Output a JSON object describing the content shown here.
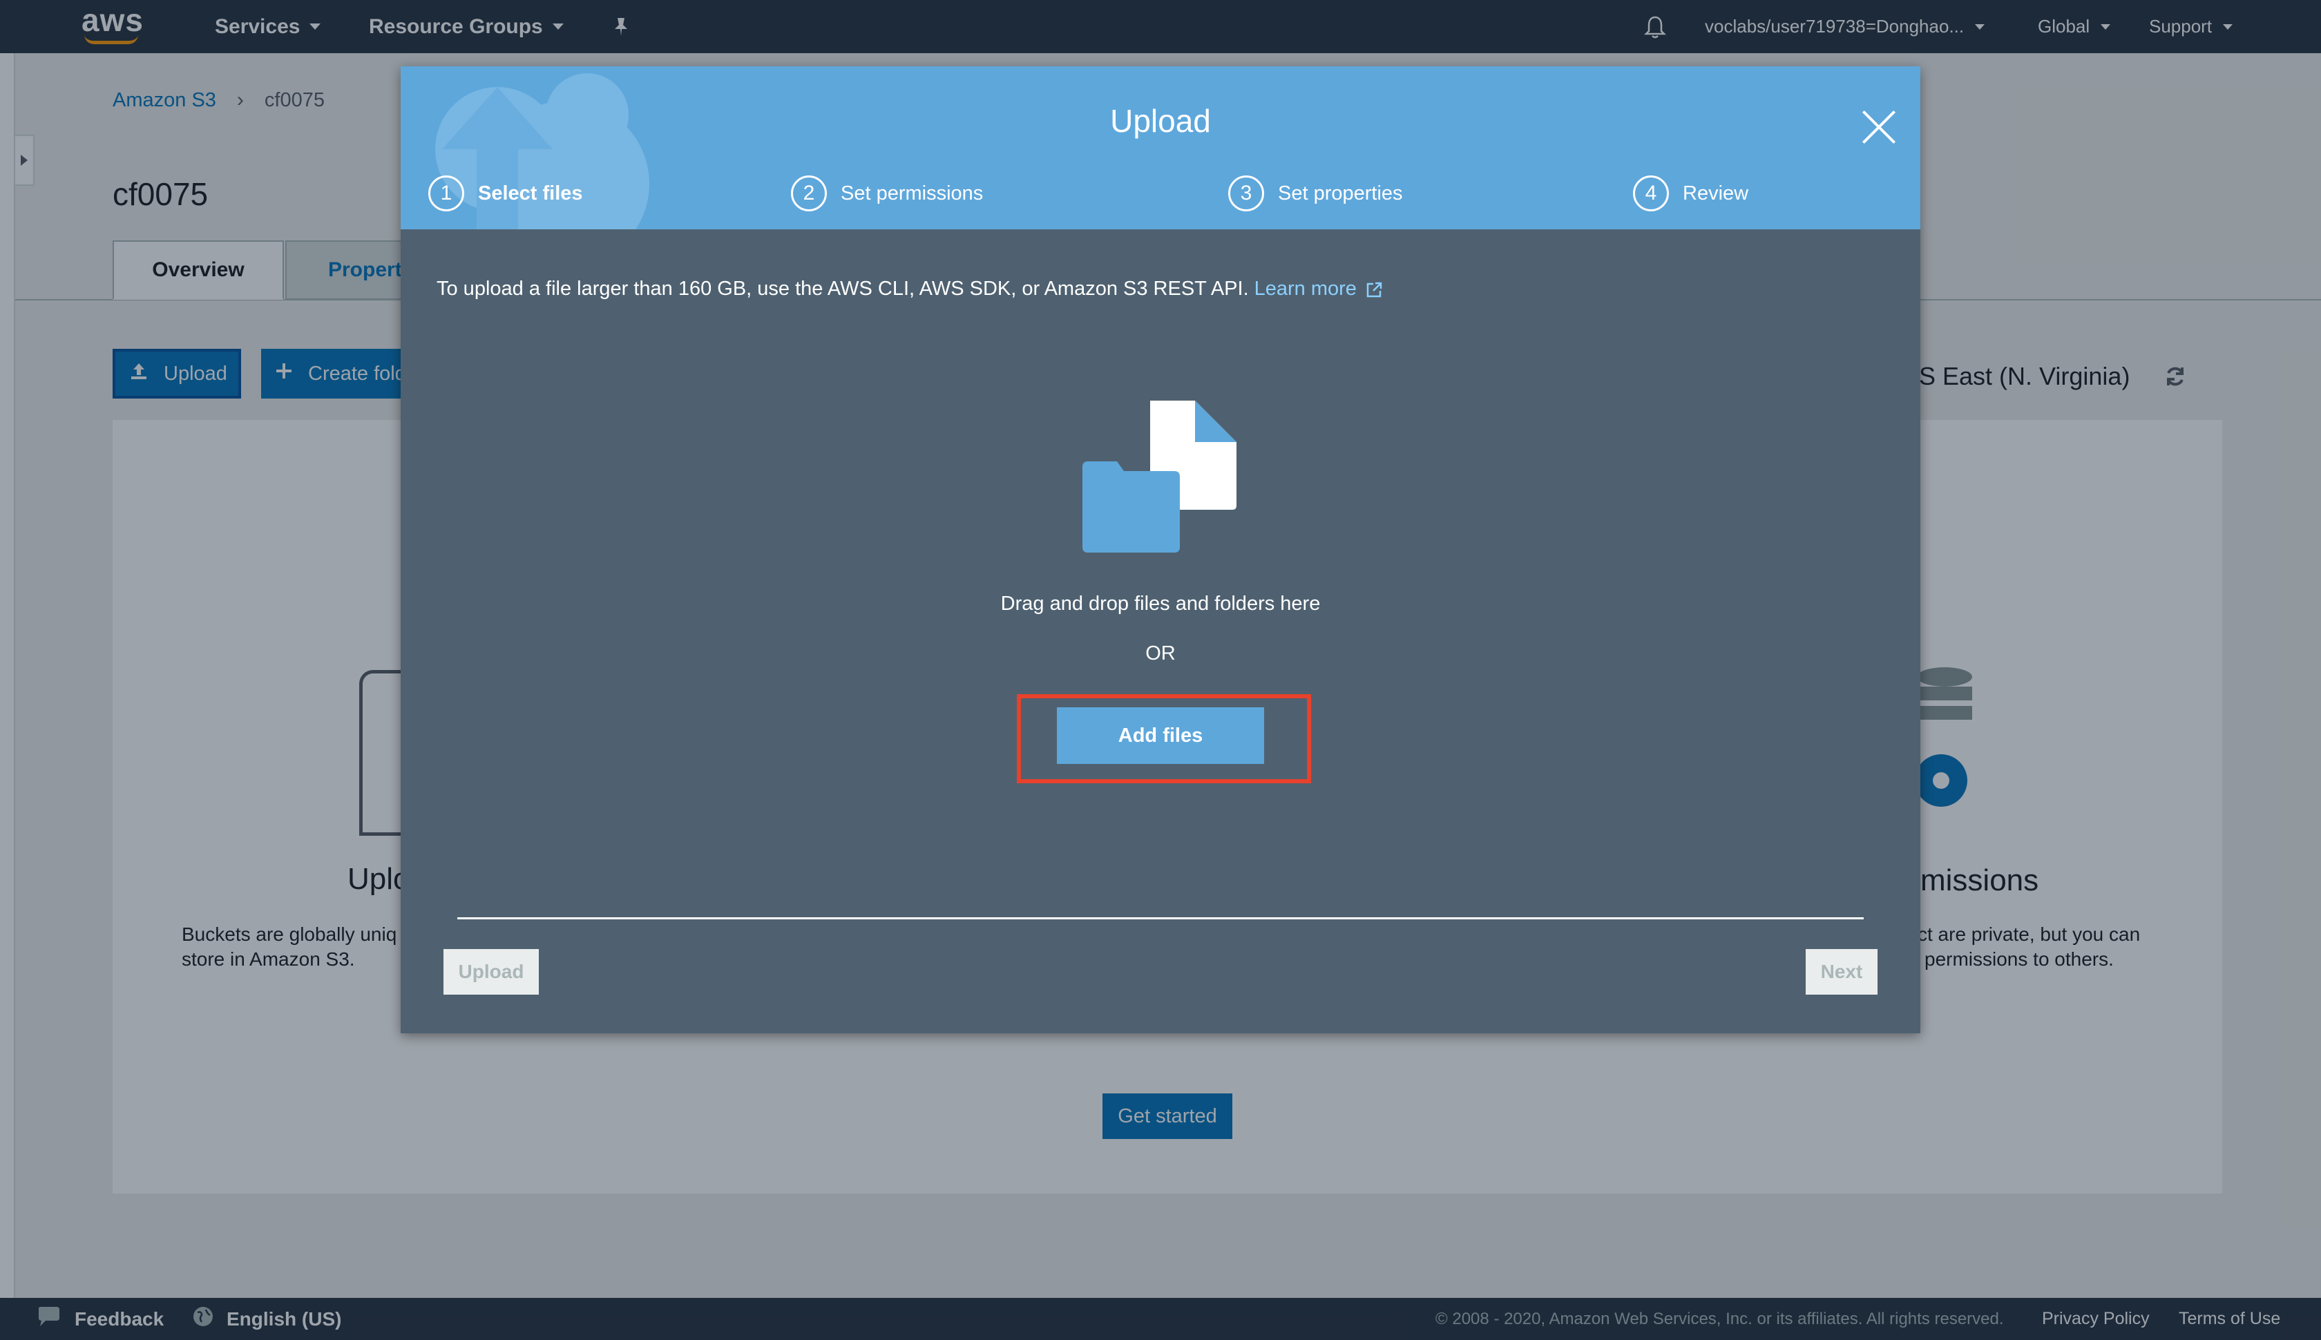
{
  "topnav": {
    "logo_text": "aws",
    "services": "Services",
    "resource_groups": "Resource Groups",
    "account": "voclabs/user719738=Donghao...",
    "region": "Global",
    "support": "Support"
  },
  "page": {
    "breadcrumb": {
      "root": "Amazon S3",
      "separator": "›",
      "current": "cf0075"
    },
    "bucket_title": "cf0075",
    "tabs": {
      "overview": "Overview",
      "properties": "Properti"
    },
    "toolbar": {
      "upload": "Upload",
      "create_folder": "Create fold"
    },
    "region_label": "JS East (N. Virginia)",
    "panel": {
      "left_heading": "Uplo",
      "left_text_1": "Buckets are globally uniq",
      "left_text_2": "store in Amazon S3.",
      "right_heading": "missions",
      "right_text_1": "ct are private, but you can",
      "right_text_2": "permissions to others.",
      "get_started": "Get started"
    }
  },
  "modal": {
    "title": "Upload",
    "steps": [
      {
        "num": "1",
        "label": "Select files"
      },
      {
        "num": "2",
        "label": "Set permissions"
      },
      {
        "num": "3",
        "label": "Set properties"
      },
      {
        "num": "4",
        "label": "Review"
      }
    ],
    "info_text": "To upload a file larger than 160 GB, use the AWS CLI, AWS SDK, or Amazon S3 REST API.",
    "learn_more": "Learn more",
    "drop_text": "Drag and drop files and folders here",
    "or_text": "OR",
    "add_files": "Add files",
    "upload_button": "Upload",
    "next_button": "Next"
  },
  "footer": {
    "feedback": "Feedback",
    "language": "English (US)",
    "copyright": "© 2008 - 2020, Amazon Web Services, Inc. or its affiliates. All rights reserved.",
    "privacy": "Privacy Policy",
    "terms": "Terms of Use"
  },
  "colors": {
    "nav_bg": "#232f3e",
    "modal_header": "#5ea7db",
    "modal_body": "#4f6170",
    "highlight": "#e8412c",
    "link": "#0073bb"
  }
}
